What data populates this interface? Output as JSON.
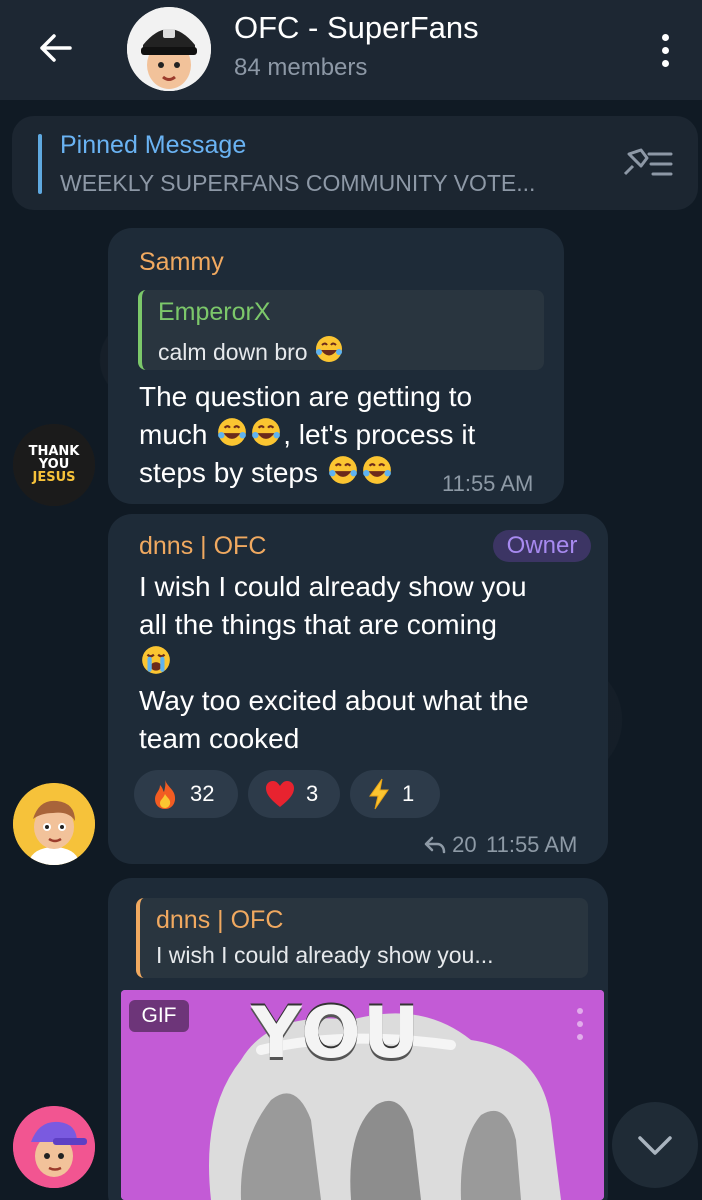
{
  "header": {
    "title": "OFC - SuperFans",
    "subtitle": "84 members",
    "back_icon": "arrow-left-icon",
    "menu_icon": "more-vertical-icon"
  },
  "pinned": {
    "title": "Pinned Message",
    "text": "WEEKLY SUPERFANS COMMUNITY VOTE..."
  },
  "messages": [
    {
      "sender": "Sammy",
      "sender_color": "#f0a960",
      "reply_to": {
        "name": "EmperorX",
        "text": "calm down bro",
        "color": "#7cc86a"
      },
      "lines": [
        "The question are getting to",
        "much",
        ", let's process it",
        "steps by steps"
      ],
      "time": "11:55 AM",
      "avatar_text": [
        "THANK",
        "YOU",
        "JESUS"
      ]
    },
    {
      "sender": "dnns | OFC",
      "sender_color": "#f0a960",
      "badge": "Owner",
      "lines": [
        "I wish I could already show you",
        "all the things that are coming",
        "Way too excited about what the",
        "team cooked"
      ],
      "reactions": [
        {
          "icon": "fire-emoji",
          "count": "32"
        },
        {
          "icon": "heart-emoji",
          "count": "3"
        },
        {
          "icon": "lightning-emoji",
          "count": "1"
        }
      ],
      "forwards": "20",
      "time": "11:55 AM"
    },
    {
      "reply_to": {
        "name": "dnns | OFC",
        "text": "I wish I could already show you...",
        "color": "#f0a960"
      },
      "gif_badge": "GIF",
      "gif_caption": "YOU"
    }
  ],
  "colors": {
    "header_bg": "#1d2733",
    "bubble_bg": "#1e2b38",
    "accent_blue": "#6ab3f3",
    "owner_purple": "#a78af0"
  }
}
